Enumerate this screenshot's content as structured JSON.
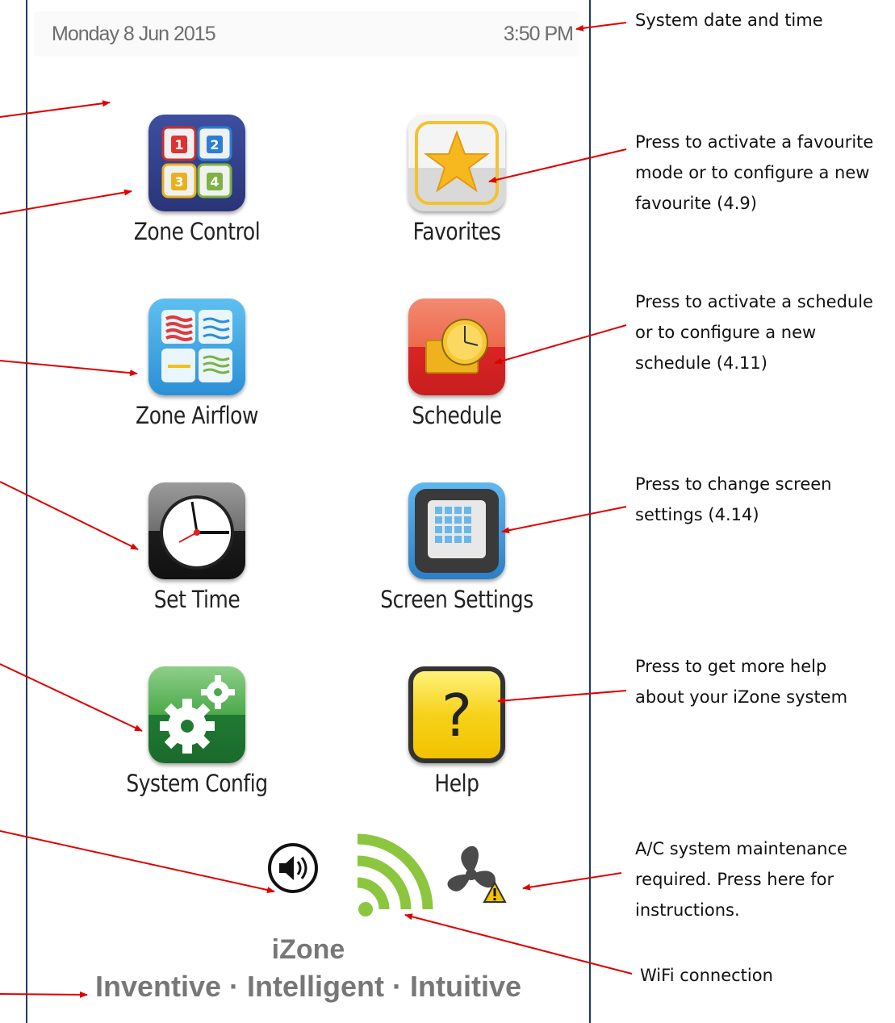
{
  "statusbar": {
    "date": "Monday 8 Jun 2015",
    "time": "3:50 PM"
  },
  "apps": {
    "zone_control": "Zone Control",
    "favorites": "Favorites",
    "zone_airflow": "Zone Airflow",
    "schedule": "Schedule",
    "set_time": "Set Time",
    "screen_settings": "Screen Settings",
    "system_config": "System Config",
    "help": "Help"
  },
  "zone_numbers": [
    "1",
    "2",
    "3",
    "4"
  ],
  "help_glyph": "?",
  "brand": {
    "name": "iZone",
    "tagline": "Inventive · Intelligent · Intuitive"
  },
  "annotations": {
    "datetime": "System date and  time",
    "favourite": [
      "Press to activate a favourite",
      "mode or to configure a new",
      "favourite (4.9)"
    ],
    "schedule": [
      "Press to activate a schedule",
      "or to configure a new",
      "schedule (4.11)"
    ],
    "screen": [
      "Press to change screen",
      "settings (4.14)"
    ],
    "help": [
      "Press to get more help",
      "about your iZone system"
    ],
    "maintenance": [
      "A/C system maintenance",
      "required. Press here for",
      "instructions."
    ],
    "wifi": "WiFi connection"
  },
  "colors": {
    "arrow": "#e00000",
    "frame": "#1f3a5f",
    "wifi": "#8cc63f"
  }
}
